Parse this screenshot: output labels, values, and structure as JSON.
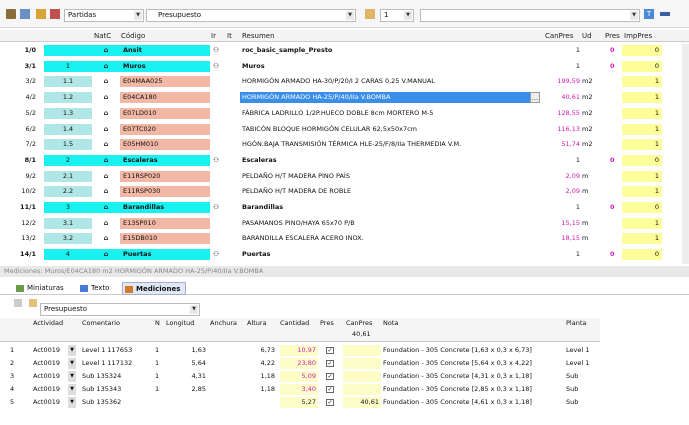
{
  "toolbar": {
    "combo1": "Partidas",
    "combo2": "Presupuesto",
    "combo3": "1"
  },
  "columns": [
    "NatC",
    "Código",
    "Ir",
    "It",
    "Resumen",
    "CanPres",
    "Ud",
    "Pres",
    "ImpPres"
  ],
  "rows": [
    {
      "id": "1/0",
      "lvl": "",
      "code": "Ansit",
      "res": "roc_basic_sample_Presto",
      "can": "1",
      "ud": "",
      "imp": "0",
      "type": "root"
    },
    {
      "id": "3/1",
      "lvl": "1",
      "code": "Muros",
      "res": "Muros",
      "can": "1",
      "ud": "",
      "imp": "0",
      "type": "chapter"
    },
    {
      "id": "3/2",
      "lvl": "1.1",
      "code": "E04MAA025",
      "res": "HORMIGÓN ARMADO HA-30/P/20/I 2 CARAS 0,25 V.MANUAL",
      "can": "199,59",
      "ud": "m2",
      "imp": "1",
      "type": "item"
    },
    {
      "id": "4/2",
      "lvl": "1.2",
      "code": "E04CA180",
      "res": "HORMIGÓN ARMADO HA-25/P/40/IIa V.BOMBA",
      "can": "40,61",
      "ud": "m2",
      "imp": "1",
      "type": "sel"
    },
    {
      "id": "5/2",
      "lvl": "1.3",
      "code": "E07LD010",
      "res": "FÁBRICA LADRILLO 1/2P.HUECO DOBLE 8cm MORTERO M-5",
      "can": "128,55",
      "ud": "m2",
      "imp": "1",
      "type": "item"
    },
    {
      "id": "6/2",
      "lvl": "1.4",
      "code": "E07TC020",
      "res": "TABICÓN BLOQUE HORMIGÓN CELULAR 62,5x50x7cm",
      "can": "116,13",
      "ud": "m2",
      "imp": "1",
      "type": "item"
    },
    {
      "id": "7/2",
      "lvl": "1.5",
      "code": "E05HM010",
      "res": "HGÓN.BAJA TRANSMISIÓN TÉRMICA HLE-25/F/8/IIa THERMEDIA V.M.",
      "can": "51,74",
      "ud": "m2",
      "imp": "1",
      "type": "item"
    },
    {
      "id": "8/1",
      "lvl": "2",
      "code": "Escaleras",
      "res": "Escaleras",
      "can": "1",
      "ud": "",
      "imp": "0",
      "type": "chapter"
    },
    {
      "id": "9/2",
      "lvl": "2.1",
      "code": "E11RSP020",
      "res": "PELDAÑO H/T MADERA PINO PAÍS",
      "can": "2,09",
      "ud": "m",
      "imp": "1",
      "type": "item"
    },
    {
      "id": "10/2",
      "lvl": "2.2",
      "code": "E11RSP030",
      "res": "PELDAÑO H/T MADERA DE ROBLE",
      "can": "2,09",
      "ud": "m",
      "imp": "1",
      "type": "item"
    },
    {
      "id": "11/1",
      "lvl": "3",
      "code": "Barandillas",
      "res": "Barandillas",
      "can": "1",
      "ud": "",
      "imp": "0",
      "type": "chapter"
    },
    {
      "id": "12/2",
      "lvl": "3.1",
      "code": "E13SP010",
      "res": "PASAMANOS PINO/HAYA 65x70 P/B",
      "can": "15,15",
      "ud": "m",
      "imp": "1",
      "type": "item"
    },
    {
      "id": "13/2",
      "lvl": "3.2",
      "code": "E15DB010",
      "res": "BARANDILLA ESCALERA ACERO INOX.",
      "can": "18,15",
      "ud": "m",
      "imp": "1",
      "type": "item"
    },
    {
      "id": "14/1",
      "lvl": "4",
      "code": "Puertas",
      "res": "Puertas",
      "can": "1",
      "ud": "",
      "imp": "0",
      "type": "chapter"
    }
  ],
  "status": "Mediciones: Muros/E04CA180 m2 HORMIGÓN ARMADO HA-25/P/40/IIa V.BOMBA",
  "tabs": [
    "Miniaturas",
    "Texto",
    "Mediciones"
  ],
  "mcombo": "Presupuesto",
  "mcols": [
    "Actividad",
    "Comentario",
    "N",
    "Longitud",
    "Anchura",
    "Altura",
    "Cantidad",
    "Pres",
    "CanPres",
    "Nota",
    "Planta"
  ],
  "mcanpres_total": "40,61",
  "mrows": [
    {
      "n": "1",
      "act": "Act0019",
      "com": "Level 1 117653",
      "N": "1",
      "lon": "1,63",
      "anc": "",
      "alt": "6,73",
      "can": "10,97",
      "nota": "Foundation - 305 Concrete [1,63 x 0,3 x 6,73]",
      "pl": "Level 1"
    },
    {
      "n": "2",
      "act": "Act0019",
      "com": "Level 1 117132",
      "N": "1",
      "lon": "5,64",
      "anc": "",
      "alt": "4,22",
      "can": "23,80",
      "nota": "Foundation - 305 Concrete [5,64 x 0,3 x 4,22]",
      "pl": "Level 1"
    },
    {
      "n": "3",
      "act": "Act0019",
      "com": "Sub 135324",
      "N": "1",
      "lon": "4,31",
      "anc": "",
      "alt": "1,18",
      "can": "5,09",
      "nota": "Foundation - 305 Concrete [4,31 x 0,3 x 1,18]",
      "pl": "Sub"
    },
    {
      "n": "4",
      "act": "Act0019",
      "com": "Sub 135343",
      "N": "1",
      "lon": "2,85",
      "anc": "",
      "alt": "1,18",
      "can": "3,40",
      "nota": "Foundation - 305 Concrete [2,85 x 0,3 x 1,18]",
      "pl": "Sub"
    },
    {
      "n": "5",
      "act": "Act0019",
      "com": "Sub 135362",
      "N": "",
      "lon": "",
      "anc": "",
      "alt": "",
      "can": "5,27",
      "canp": "40,61",
      "nota": "Foundation - 305 Concrete [4,61 x 0,3 x 1,18]",
      "pl": "Sub"
    }
  ]
}
